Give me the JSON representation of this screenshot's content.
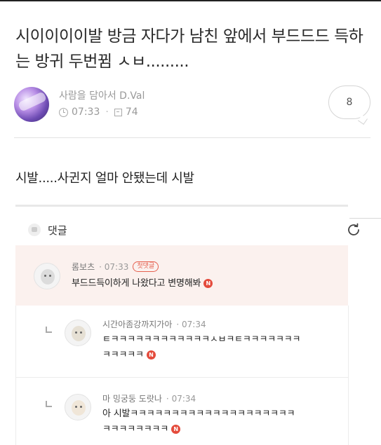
{
  "post": {
    "title": "시이이이이발 방금 자다가 남친 앞에서 부드드드 득하는 방귀 두번뀜 ㅅㅂ.........",
    "author": "사람을 담아서 D.Val",
    "time": "07:33",
    "views": "74",
    "comment_count": "8",
    "body": "시발.....사귄지 얼마 안됐는데 시발"
  },
  "comments": {
    "header_label": "댓글",
    "items": [
      {
        "author": "롬보츠",
        "time": "07:33",
        "badge": "첫댓글",
        "text": "부드드득이하게 나왔다고 변명해봐",
        "new_badge": "N"
      },
      {
        "author": "시간아좀강까지가아",
        "time": "07:34",
        "text_line1": "ㅌㅋㅋㅋㅋㅋㅋㅋㅋㅋㅋㅋㅋㅅㅂㅋㅌㅋㅋㅋㅋㅋㅋㅋ",
        "text_line2": "ㅋㅋㅋㅋㅋ",
        "new_badge": "N"
      },
      {
        "author": "마 밍궁둥 도랏나",
        "time": "07:34",
        "text_line1": "아 시발ㅋㅋㅋㅋㅋㅋㅋㅋㅋㅋㅋㅋㅋㅋㅋㅋㅋㅋㅋㅋ",
        "text_line2": "ㅋㅋㅋㅋㅋㅋㅋㅋ",
        "new_badge": "N"
      }
    ]
  },
  "colors": {
    "highlight_bg": "#fbf1ee",
    "new_badge": "#e44b3c",
    "first_badge": "#e5604f"
  }
}
